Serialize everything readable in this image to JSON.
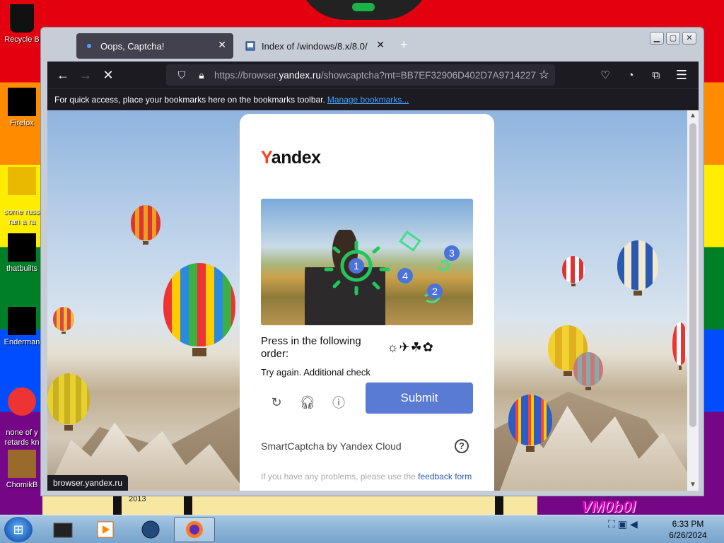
{
  "desktop": {
    "icons": [
      {
        "label": "Recycle B",
        "name": "recycle-bin"
      },
      {
        "label": "Firefox",
        "name": "firefox"
      },
      {
        "label": "some russ\nran a ra",
        "name": "some-russ"
      },
      {
        "label": "thatbuilts",
        "name": "thatbuilts"
      },
      {
        "label": "Enderman",
        "name": "enderman"
      },
      {
        "label": "none of y\nretards kn",
        "name": "none-of-y"
      },
      {
        "label": "ChomikB",
        "name": "chomik"
      }
    ],
    "year_label": "2013",
    "vm_text": "VM0b0l"
  },
  "browser": {
    "tabs": [
      {
        "title": "Oops, Captcha!",
        "active": true
      },
      {
        "title": "Index of /windows/8.x/8.0/",
        "active": false
      }
    ],
    "url_prefix": "https://browser.",
    "url_domain": "yandex.ru",
    "url_rest": "/showcaptcha?mt=BB7EF32906D402D7A9714227",
    "bookmarks_hint": "For quick access, place your bookmarks here on the bookmarks toolbar.",
    "manage_bookmarks": "Manage bookmarks...",
    "status_url": "browser.yandex.ru"
  },
  "captcha": {
    "logo_first": "Y",
    "logo_rest": "andex",
    "points": [
      "1",
      "2",
      "3",
      "4"
    ],
    "prompt": "Press in the following order:",
    "order_icons": "☼✈☘✿",
    "retry_text": "Try again. Additional check",
    "submit_label": "Submit",
    "branding": "SmartCaptcha by Yandex Cloud",
    "problems_text": "If you have any problems, please use the",
    "feedback_link": "feedback form"
  },
  "taskbar": {
    "time": "6:33 PM",
    "date": "6/26/2024"
  }
}
